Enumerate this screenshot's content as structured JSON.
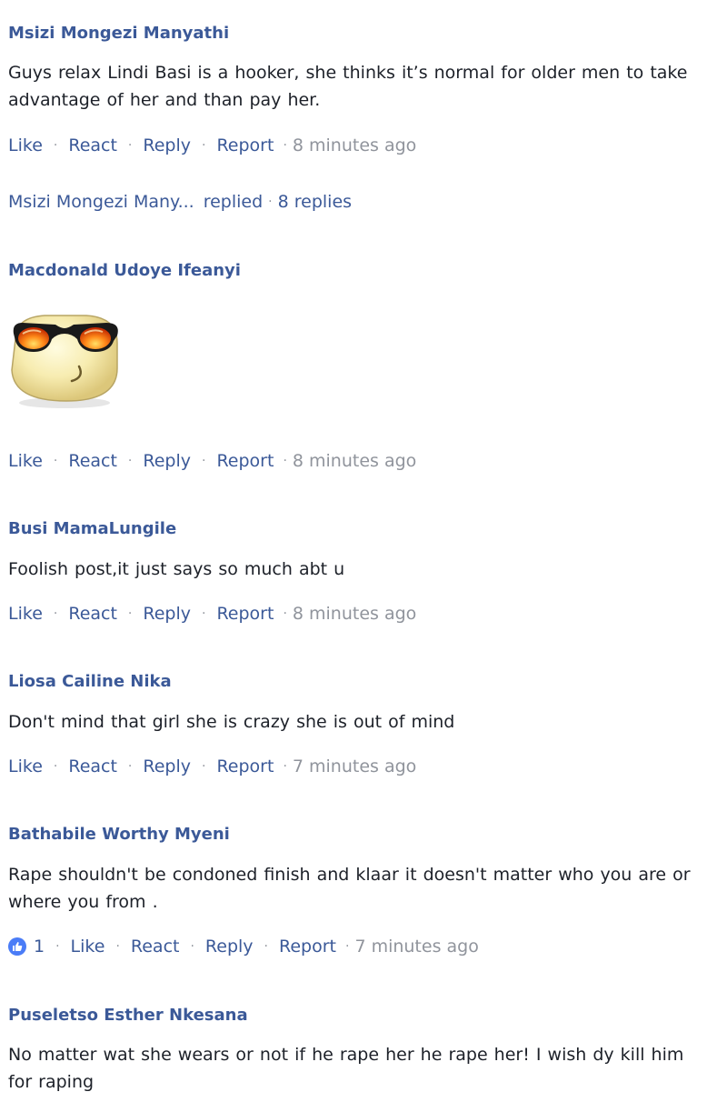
{
  "actions": {
    "like": "Like",
    "react": "React",
    "reply": "Reply",
    "report": "Report",
    "dot": "·"
  },
  "comments": [
    {
      "author": "Msizi Mongezi Manyathi",
      "text": "Guys relax Lindi Basi is a hooker, she thinks it’s normal for older men to take advantage of her and than pay her.",
      "time": "8 minutes ago",
      "replies": {
        "author": "Msizi Mongezi Many...",
        "action": "replied",
        "count": "8 replies"
      }
    },
    {
      "author": "Macdonald Udoye Ifeanyi",
      "sticker": "cool-sunglasses-face-sticker",
      "time": "8 minutes ago"
    },
    {
      "author": "Busi MamaLungile",
      "text": "Foolish post,it just says so much abt u",
      "time": "8 minutes ago"
    },
    {
      "author": "Liosa Cailine Nika",
      "text": "Don't mind that girl she is crazy she is out of mind",
      "time": "7 minutes ago"
    },
    {
      "author": "Bathabile Worthy Myeni",
      "text": "Rape shouldn't be condoned finish and klaar it doesn't matter who you are or where you from .",
      "time": "7 minutes ago",
      "likes": "1",
      "like_icon": "thumbs-up-icon"
    },
    {
      "author": "Puseletso Esther Nkesana",
      "text": "No matter wat she wears or not if he rape her he rape her! I wish dy kill him for raping"
    }
  ],
  "colors": {
    "link": "#3b5998",
    "text": "#1d2129",
    "meta": "#90949c",
    "like_badge": "#4a7cf7"
  }
}
